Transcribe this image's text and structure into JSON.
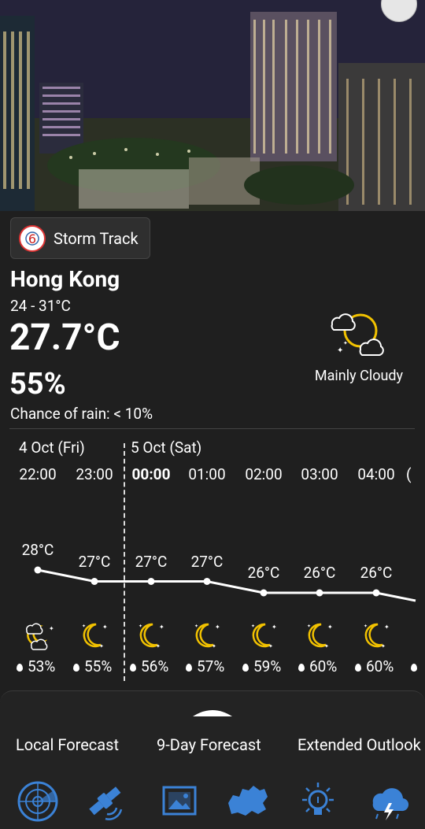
{
  "storm_track": {
    "label": "Storm Track"
  },
  "location": {
    "city": "Hong Kong",
    "temp_range": "24 - 31°C",
    "temperature": "27.7°C",
    "humidity": "55%",
    "chance_of_rain": "Chance of rain: < 10%",
    "condition": "Mainly Cloudy",
    "condition_icon": "moon-cloud-icon"
  },
  "hourly": {
    "days": [
      "4 Oct (Fri)",
      "5 Oct (Sat)"
    ],
    "hours": [
      "22:00",
      "23:00",
      "00:00",
      "01:00",
      "02:00",
      "03:00",
      "04:00"
    ],
    "temps": [
      "28°C",
      "27°C",
      "27°C",
      "27°C",
      "26°C",
      "26°C",
      "26°C"
    ],
    "temp_values": [
      28,
      27,
      27,
      27,
      26,
      26,
      26
    ],
    "rain": [
      "53%",
      "55%",
      "56%",
      "57%",
      "59%",
      "60%",
      "60%"
    ],
    "icons": [
      "cloudy-moon-icon",
      "crescent-moon-icon",
      "crescent-moon-icon",
      "crescent-moon-icon",
      "crescent-moon-icon",
      "crescent-moon-icon",
      "crescent-moon-icon"
    ]
  },
  "tabs": [
    "Local Forecast",
    "9-Day Forecast",
    "Extended Outlook"
  ],
  "bottom_icons": [
    "radar-icon",
    "satellite-icon",
    "image-icon",
    "map-icon",
    "bulb-icon",
    "thunderstorm-icon"
  ]
}
